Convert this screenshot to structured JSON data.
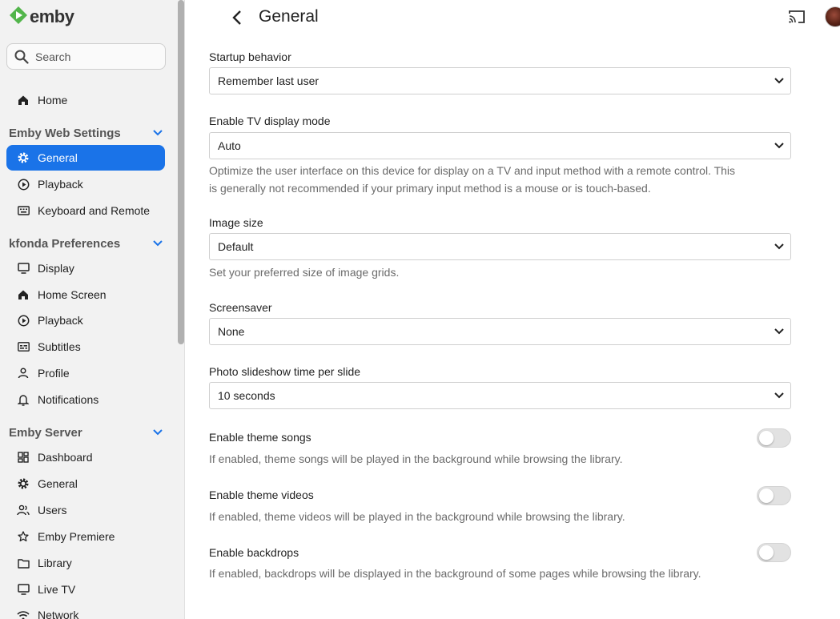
{
  "brand": {
    "name": "emby",
    "color": "#52b54b"
  },
  "accent": "#1a73e8",
  "search": {
    "label": "Search",
    "icon": "search-icon"
  },
  "sidebar": {
    "home": "Home",
    "web_settings": {
      "title": "Emby Web Settings",
      "items": [
        "General",
        "Playback",
        "Keyboard and Remote"
      ]
    },
    "preferences": {
      "title": "kfonda Preferences",
      "items": [
        "Display",
        "Home Screen",
        "Playback",
        "Subtitles",
        "Profile",
        "Notifications"
      ]
    },
    "server": {
      "title": "Emby Server",
      "items": [
        "Dashboard",
        "General",
        "Users",
        "Emby Premiere",
        "Library",
        "Live TV",
        "Network"
      ]
    }
  },
  "header": {
    "title": "General"
  },
  "form": {
    "startup": {
      "label": "Startup behavior",
      "value": "Remember last user"
    },
    "tv_mode": {
      "label": "Enable TV display mode",
      "value": "Auto",
      "desc_line1": "Optimize the user interface on this device for display on a TV and input method with a remote control. This",
      "desc_line2": "is generally not recommended if your primary input method is a mouse or is touch-based."
    },
    "image_size": {
      "label": "Image size",
      "value": "Default",
      "desc": "Set your preferred size of image grids."
    },
    "screensaver": {
      "label": "Screensaver",
      "value": "None"
    },
    "slideshow": {
      "label": "Photo slideshow time per slide",
      "value": "10 seconds"
    },
    "theme_songs": {
      "label": "Enable theme songs",
      "desc": "If enabled, theme songs will be played in the background while browsing the library.",
      "enabled": false
    },
    "theme_videos": {
      "label": "Enable theme videos",
      "desc": "If enabled, theme videos will be played in the background while browsing the library.",
      "enabled": false
    },
    "backdrops": {
      "label": "Enable backdrops",
      "desc": "If enabled, backdrops will be displayed in the background of some pages while browsing the library.",
      "enabled": false
    }
  }
}
